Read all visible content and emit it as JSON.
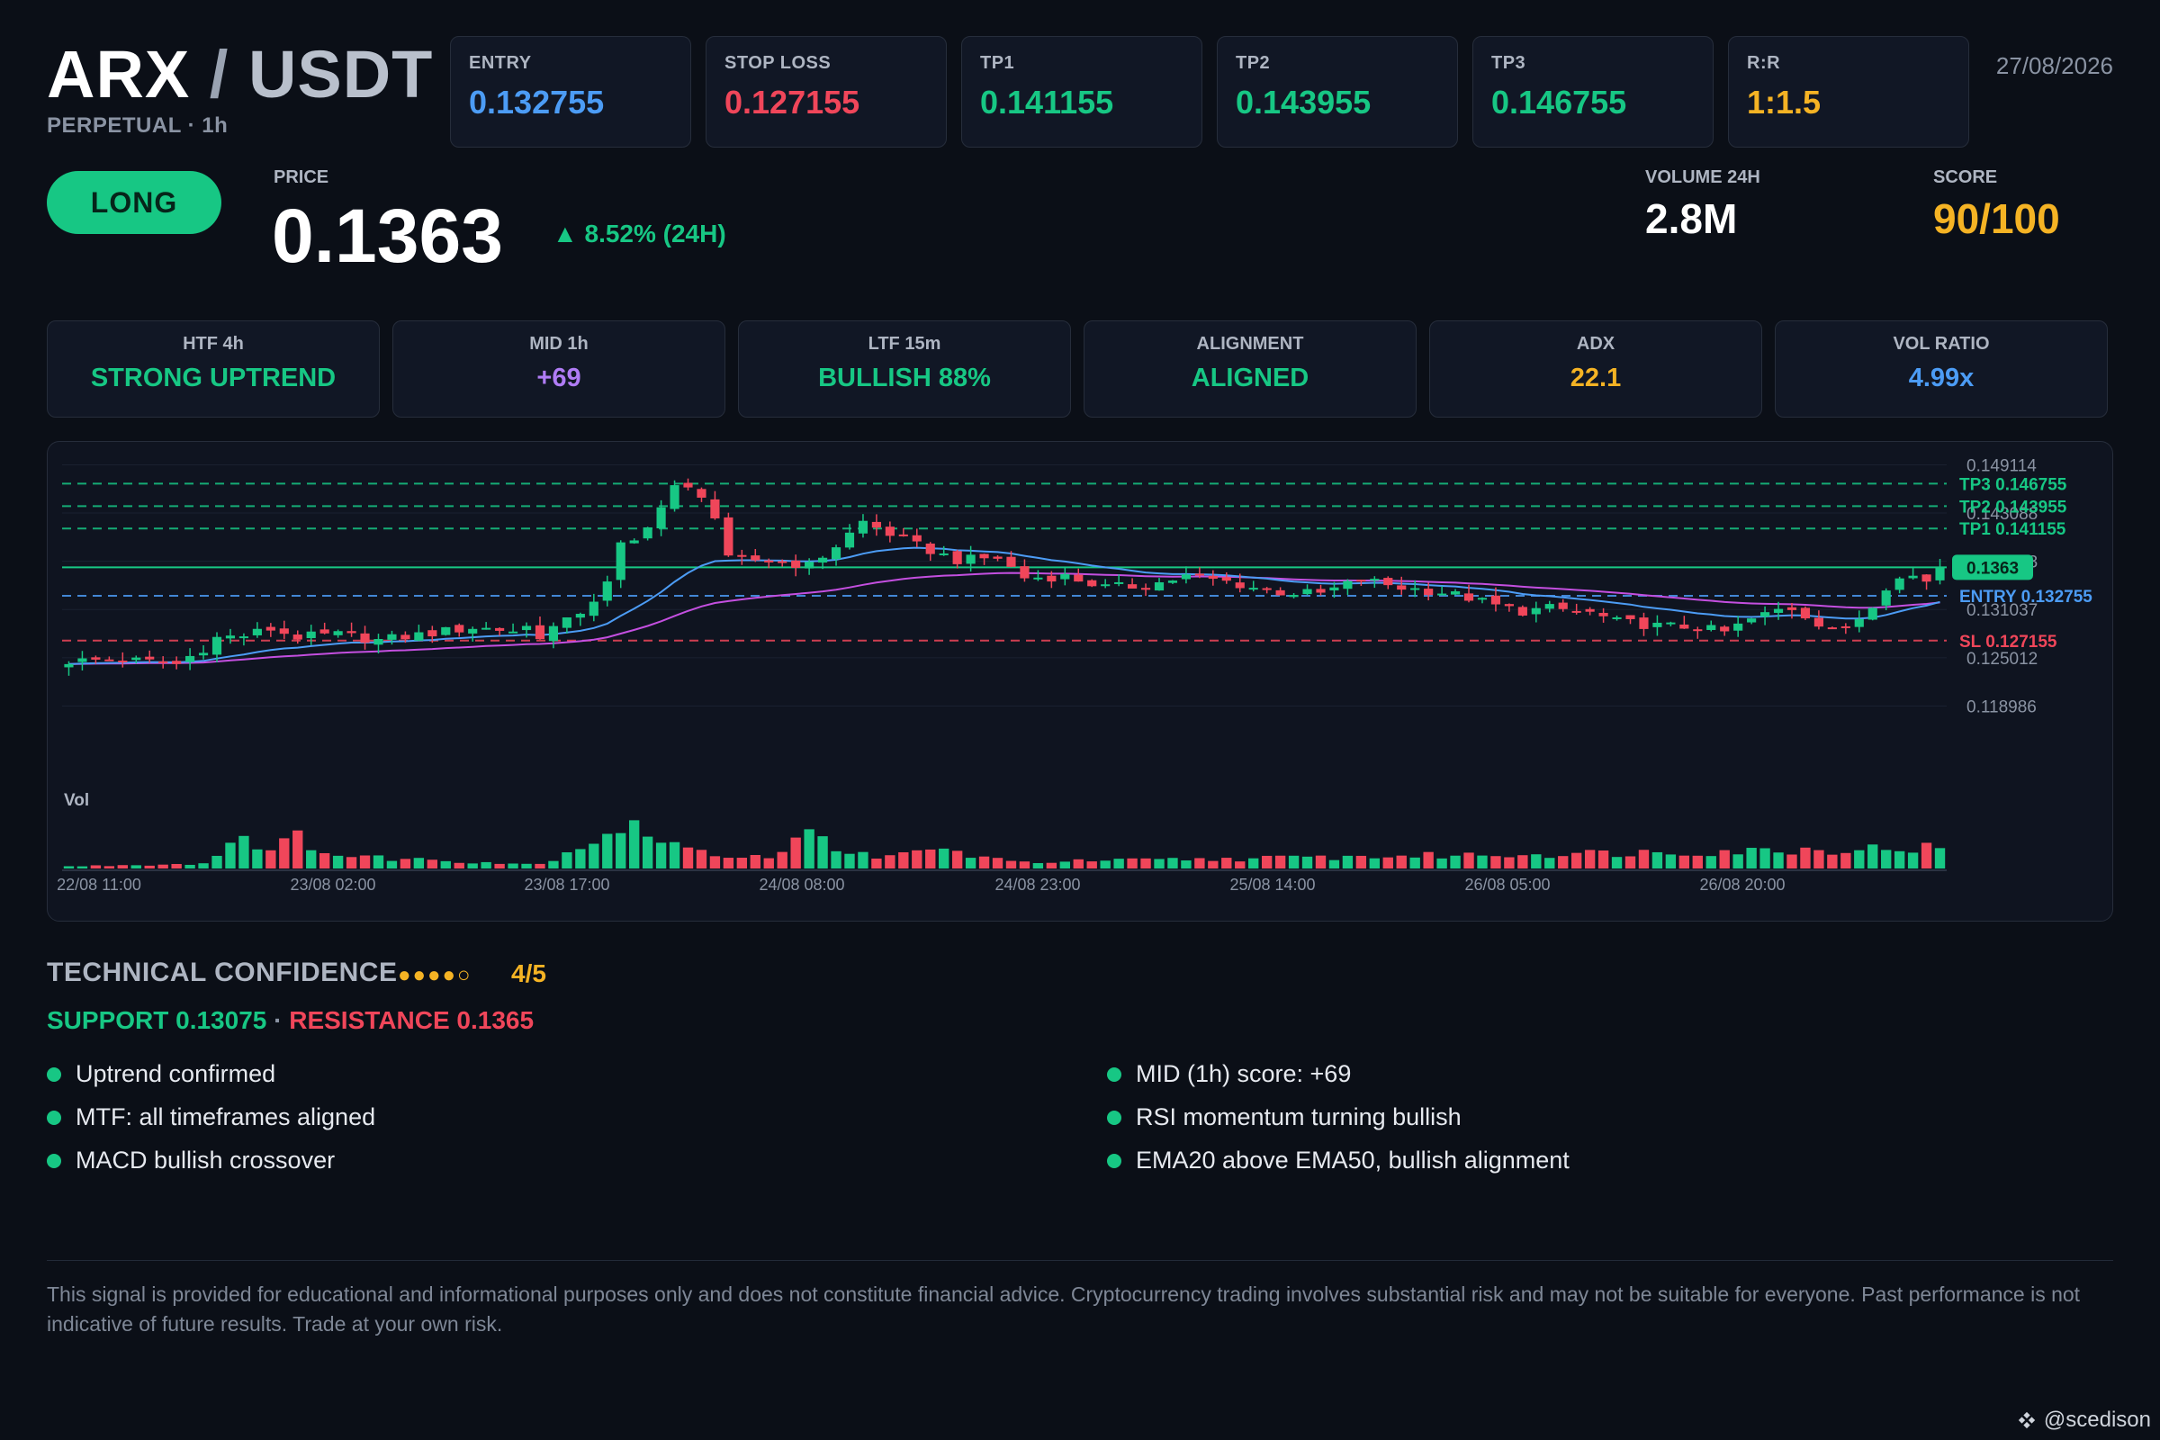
{
  "header": {
    "base": "ARX",
    "separator": " / ",
    "quote": "USDT",
    "subtitle": "PERPETUAL · 1h",
    "date": "27/08/2026"
  },
  "levels": [
    {
      "label": "ENTRY",
      "value": "0.132755",
      "color": "#4c9cf5"
    },
    {
      "label": "STOP LOSS",
      "value": "0.127155",
      "color": "#f0465a"
    },
    {
      "label": "TP1",
      "value": "0.141155",
      "color": "#17c784"
    },
    {
      "label": "TP2",
      "value": "0.143955",
      "color": "#17c784"
    },
    {
      "label": "TP3",
      "value": "0.146755",
      "color": "#17c784"
    },
    {
      "label": "R:R",
      "value": "1:1.5",
      "color": "#f5b324"
    }
  ],
  "signal": {
    "direction": "LONG",
    "price_label": "PRICE",
    "price": "0.1363",
    "change": "▲ 8.52% (24H)",
    "volume_label": "VOLUME 24H",
    "volume": "2.8M",
    "score_label": "SCORE",
    "score": "90/100"
  },
  "timeframes": [
    {
      "label": "HTF 4h",
      "value": "STRONG UPTREND",
      "color": "#17c784"
    },
    {
      "label": "MID 1h",
      "value": "+69",
      "color": "#b07cf5"
    },
    {
      "label": "LTF 15m",
      "value": "BULLISH 88%",
      "color": "#17c784"
    },
    {
      "label": "ALIGNMENT",
      "value": "ALIGNED",
      "color": "#17c784"
    },
    {
      "label": "ADX",
      "value": "22.1",
      "color": "#f5b324"
    },
    {
      "label": "VOL RATIO",
      "value": "4.99x",
      "color": "#4c9cf5"
    }
  ],
  "chart_data": {
    "type": "candlestick",
    "x_tick_labels": [
      "22/08 11:00",
      "23/08 02:00",
      "23/08 17:00",
      "24/08 08:00",
      "24/08 23:00",
      "25/08 14:00",
      "26/08 05:00",
      "26/08 20:00"
    ],
    "y_tick_labels": [
      "0.149114",
      "0.143088",
      "0.137063",
      "0.131037",
      "0.125012",
      "0.118986"
    ],
    "ylim": [
      0.116,
      0.1504
    ],
    "volume_label": "Vol",
    "lines": [
      {
        "label": "TP3 0.146755",
        "value": 0.146755,
        "color": "#17c784",
        "style": "dashed"
      },
      {
        "label": "TP2 0.143955",
        "value": 0.143955,
        "color": "#17c784",
        "style": "dashed"
      },
      {
        "label": "TP1 0.141155",
        "value": 0.141155,
        "color": "#17c784",
        "style": "dashed"
      },
      {
        "label": "ENTRY 0.132755",
        "value": 0.132755,
        "color": "#4c9cf5",
        "style": "dashed"
      },
      {
        "label": "SL 0.127155",
        "value": 0.127155,
        "color": "#f0465a",
        "style": "dashed"
      }
    ],
    "current_price": {
      "label": "0.1363",
      "value": 0.1363,
      "color": "#17c784"
    },
    "candle_count": 140,
    "close_anchors": [
      [
        0,
        0.1246
      ],
      [
        4,
        0.1248
      ],
      [
        8,
        0.1242
      ],
      [
        9,
        0.1252
      ],
      [
        10,
        0.1262
      ],
      [
        11,
        0.1275
      ],
      [
        13,
        0.1278
      ],
      [
        15,
        0.1286
      ],
      [
        17,
        0.1276
      ],
      [
        20,
        0.1279
      ],
      [
        23,
        0.1272
      ],
      [
        27,
        0.1281
      ],
      [
        30,
        0.1288
      ],
      [
        33,
        0.1284
      ],
      [
        34,
        0.1289
      ],
      [
        35,
        0.1278
      ],
      [
        36,
        0.1288
      ],
      [
        37,
        0.1295
      ],
      [
        38,
        0.1308
      ],
      [
        39,
        0.1323
      ],
      [
        40,
        0.1342
      ],
      [
        41,
        0.139
      ],
      [
        42,
        0.1395
      ],
      [
        43,
        0.1418
      ],
      [
        44,
        0.1438
      ],
      [
        45,
        0.1462
      ],
      [
        46,
        0.146
      ],
      [
        47,
        0.1455
      ],
      [
        48,
        0.1425
      ],
      [
        49,
        0.1372
      ],
      [
        51,
        0.1372
      ],
      [
        53,
        0.137
      ],
      [
        55,
        0.1365
      ],
      [
        57,
        0.139
      ],
      [
        59,
        0.142
      ],
      [
        61,
        0.1405
      ],
      [
        63,
        0.139
      ],
      [
        66,
        0.1372
      ],
      [
        69,
        0.1375
      ],
      [
        71,
        0.135
      ],
      [
        74,
        0.1352
      ],
      [
        77,
        0.1338
      ],
      [
        80,
        0.134
      ],
      [
        83,
        0.1352
      ],
      [
        86,
        0.1345
      ],
      [
        88,
        0.1338
      ],
      [
        90,
        0.1332
      ],
      [
        93,
        0.133
      ],
      [
        96,
        0.1348
      ],
      [
        99,
        0.1338
      ],
      [
        102,
        0.1332
      ],
      [
        104,
        0.1325
      ],
      [
        106,
        0.1315
      ],
      [
        108,
        0.1308
      ],
      [
        110,
        0.1312
      ],
      [
        113,
        0.1306
      ],
      [
        115,
        0.1295
      ],
      [
        118,
        0.129
      ],
      [
        121,
        0.1288
      ],
      [
        123,
        0.1282
      ],
      [
        125,
        0.1298
      ],
      [
        127,
        0.131
      ],
      [
        128,
        0.1312
      ],
      [
        130,
        0.1294
      ],
      [
        132,
        0.1284
      ],
      [
        134,
        0.1315
      ],
      [
        135,
        0.134
      ],
      [
        136,
        0.1355
      ],
      [
        137,
        0.1352
      ],
      [
        138,
        0.1345
      ],
      [
        139,
        0.1363
      ]
    ],
    "volume_anchors": [
      [
        0,
        0.05
      ],
      [
        10,
        0.12
      ],
      [
        13,
        0.85
      ],
      [
        15,
        0.4
      ],
      [
        17,
        0.75
      ],
      [
        20,
        0.3
      ],
      [
        35,
        0.1
      ],
      [
        41,
        1.0
      ],
      [
        42,
        0.95
      ],
      [
        43,
        0.9
      ],
      [
        44,
        0.7
      ],
      [
        45,
        0.6
      ],
      [
        47,
        0.35
      ],
      [
        52,
        0.3
      ],
      [
        55,
        0.8
      ],
      [
        60,
        0.2
      ],
      [
        64,
        0.5
      ],
      [
        70,
        0.15
      ],
      [
        139,
        0.5
      ]
    ],
    "ema20_color": "#4c9cf5",
    "ema50_color": "#c44fe0"
  },
  "confidence": {
    "title": "TECHNICAL CONFIDENCE",
    "dots": "●●●●○",
    "score": "4/5",
    "support": "SUPPORT 0.13075",
    "separator": " · ",
    "resistance": "RESISTANCE 0.1365"
  },
  "reasons_left": [
    "Uptrend confirmed",
    "MTF: all timeframes aligned",
    "MACD bullish crossover"
  ],
  "reasons_right": [
    "MID (1h) score: +69",
    "RSI momentum turning bullish",
    "EMA20 above EMA50, bullish alignment"
  ],
  "disclaimer": "This signal is provided for educational and informational purposes only and does not constitute financial advice. Cryptocurrency trading involves substantial risk and may not be suitable for everyone. Past performance is not indicative of future results. Trade at your own risk.",
  "watermark": "@scedison"
}
